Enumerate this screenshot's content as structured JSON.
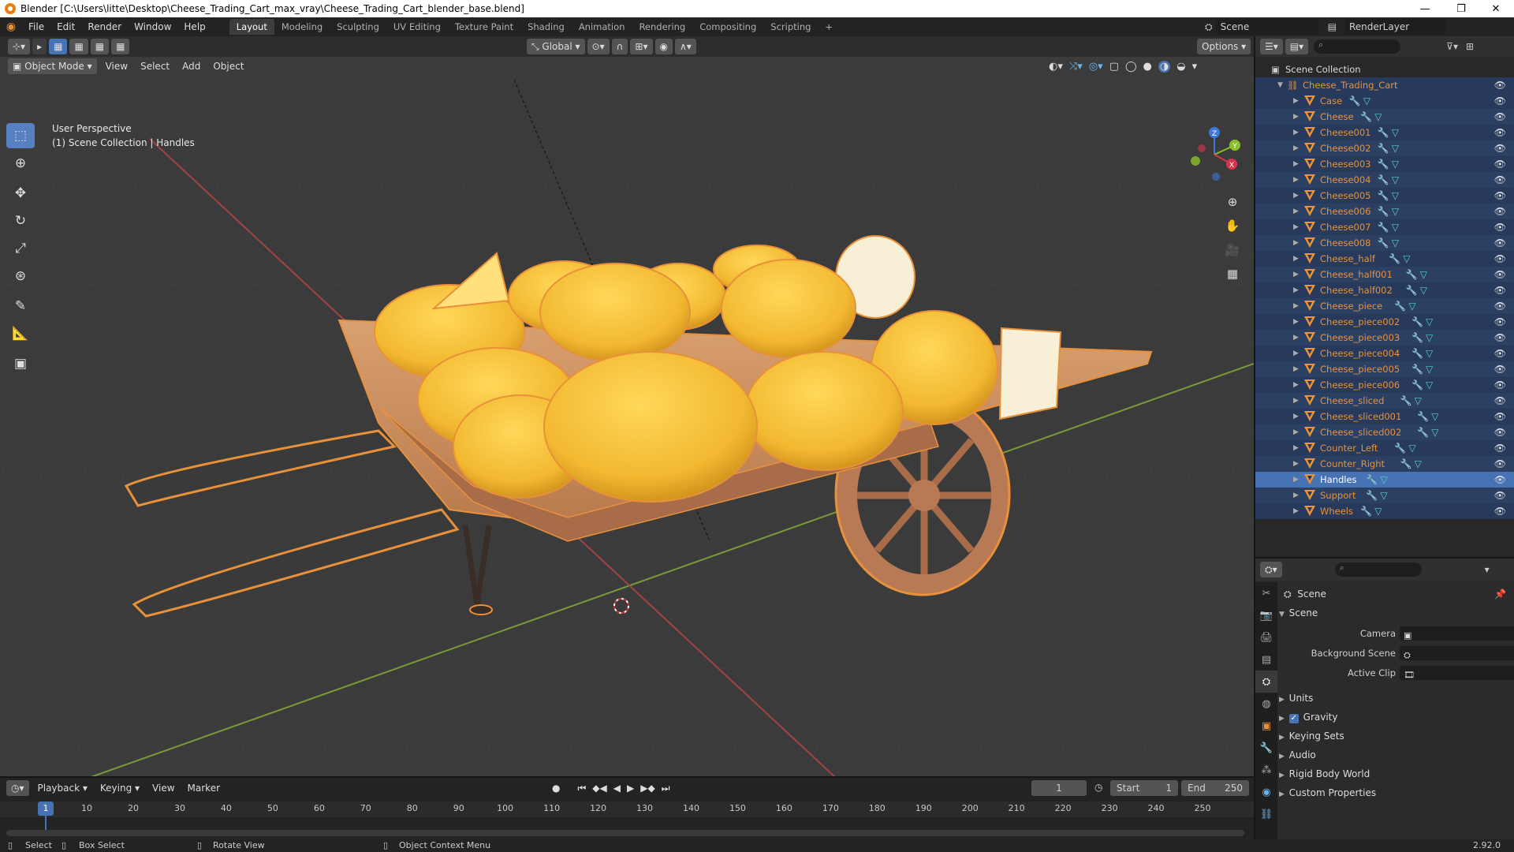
{
  "title_bar": {
    "title": "Blender [C:\\Users\\litte\\Desktop\\Cheese_Trading_Cart_max_vray\\Cheese_Trading_Cart_blender_base.blend]",
    "minimize": "—",
    "maximize": "❐",
    "close": "✕"
  },
  "top_menu": [
    "File",
    "Edit",
    "Render",
    "Window",
    "Help"
  ],
  "workspaces": [
    "Layout",
    "Modeling",
    "Sculpting",
    "UV Editing",
    "Texture Paint",
    "Shading",
    "Animation",
    "Rendering",
    "Compositing",
    "Scripting",
    "+"
  ],
  "active_workspace": "Layout",
  "scene_field": "Scene",
  "render_layer_field": "RenderLayer",
  "viewport": {
    "mode": "Object Mode",
    "menus": [
      "View",
      "Select",
      "Add",
      "Object"
    ],
    "transform_orientation": "Global",
    "options": "Options",
    "perspective_label": "User Perspective",
    "collection_label": "(1) Scene Collection | Handles",
    "gizmo_axes": {
      "x": "X",
      "y": "Y",
      "z": "Z"
    }
  },
  "outliner": {
    "root": "Scene Collection",
    "collection": "Cheese_Trading_Cart",
    "objects": [
      "Case",
      "Cheese",
      "Cheese001",
      "Cheese002",
      "Cheese003",
      "Cheese004",
      "Cheese005",
      "Cheese006",
      "Cheese007",
      "Cheese008",
      "Cheese_half",
      "Cheese_half001",
      "Cheese_half002",
      "Cheese_piece",
      "Cheese_piece002",
      "Cheese_piece003",
      "Cheese_piece004",
      "Cheese_piece005",
      "Cheese_piece006",
      "Cheese_sliced",
      "Cheese_sliced001",
      "Cheese_sliced002",
      "Counter_Left",
      "Counter_Right",
      "Handles",
      "Support",
      "Wheels"
    ],
    "selected": "Handles"
  },
  "properties": {
    "context": "Scene",
    "panel": "Scene",
    "fields": [
      {
        "label": "Camera"
      },
      {
        "label": "Background Scene"
      },
      {
        "label": "Active Clip"
      }
    ],
    "subpanels": [
      "Units",
      "Gravity",
      "Keying Sets",
      "Audio",
      "Rigid Body World",
      "Custom Properties"
    ],
    "gravity_checked": true
  },
  "timeline": {
    "menus": [
      "Playback",
      "Keying",
      "View",
      "Marker"
    ],
    "current_frame": "1",
    "start_label": "Start",
    "start": "1",
    "end_label": "End",
    "end": "250",
    "ticks": [
      "1",
      "10",
      "20",
      "30",
      "40",
      "50",
      "60",
      "70",
      "80",
      "90",
      "100",
      "110",
      "120",
      "130",
      "140",
      "150",
      "160",
      "170",
      "180",
      "190",
      "200",
      "210",
      "220",
      "230",
      "240",
      "250"
    ]
  },
  "status_bar": {
    "select": "Select",
    "box_select": "Box Select",
    "rotate_view": "Rotate View",
    "context_menu": "Object Context Menu",
    "version": "2.92.0"
  },
  "colors": {
    "selection_orange": "#e8913a",
    "active_blue": "#4772b3",
    "cheese_yellow": "#f2b830",
    "wood": "#c98a5a"
  }
}
